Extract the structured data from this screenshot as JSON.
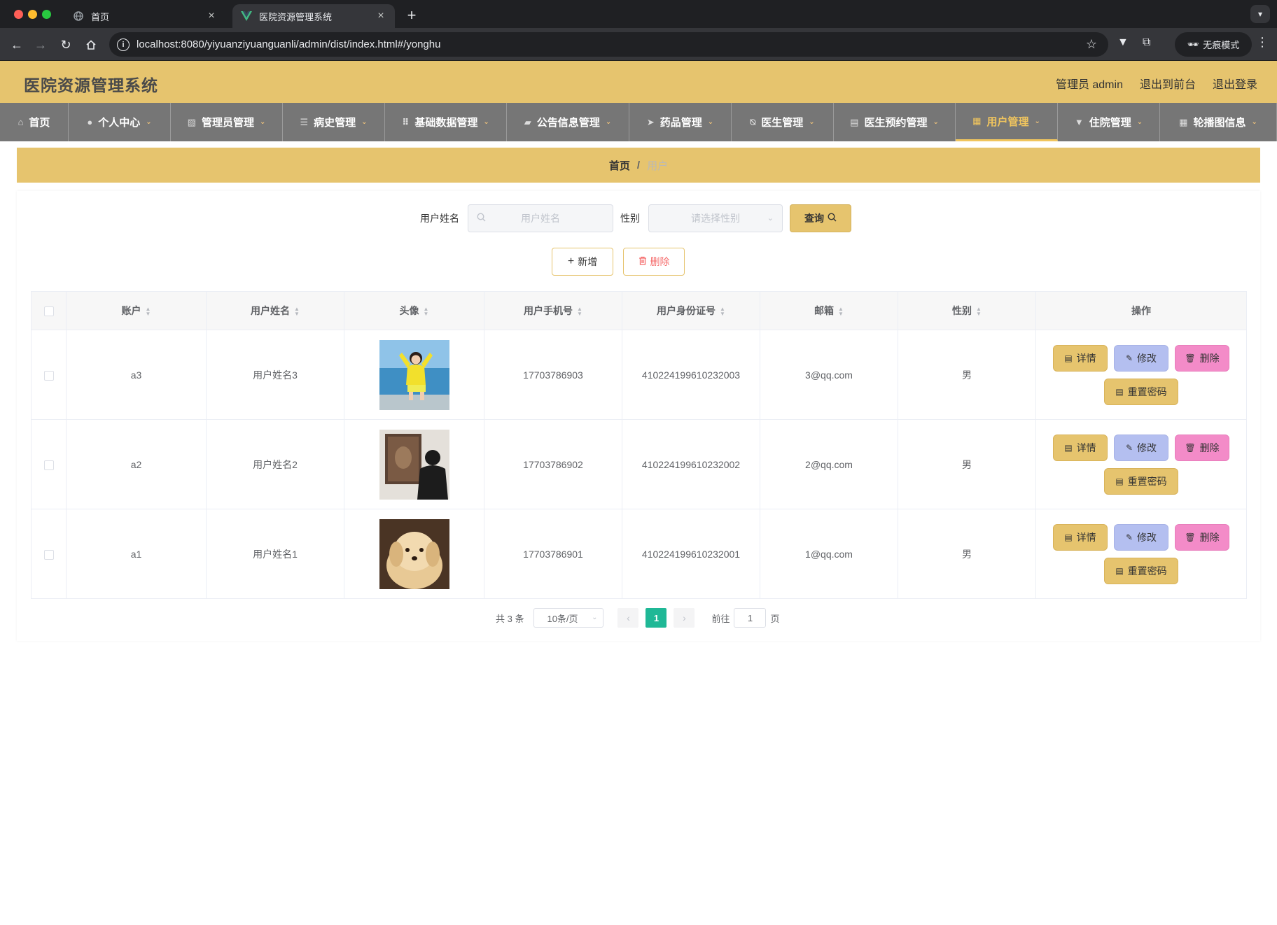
{
  "browser": {
    "tabs": [
      {
        "title": "首页",
        "active": false
      },
      {
        "title": "医院资源管理系统",
        "active": true
      }
    ],
    "url": "localhost:8080/yiyuanziyuanguanli/admin/dist/index.html#/yonghu",
    "incognito_label": "无痕模式"
  },
  "header": {
    "title": "医院资源管理系统",
    "links": [
      "管理员 admin",
      "退出到前台",
      "退出登录"
    ]
  },
  "nav": [
    {
      "label": "首页",
      "icon": "home-icon",
      "has_caret": false
    },
    {
      "label": "个人中心",
      "icon": "user-icon",
      "has_caret": true
    },
    {
      "label": "管理员管理",
      "icon": "chart-icon",
      "has_caret": true
    },
    {
      "label": "病史管理",
      "icon": "list-icon",
      "has_caret": true
    },
    {
      "label": "基础数据管理",
      "icon": "grid-icon",
      "has_caret": true
    },
    {
      "label": "公告信息管理",
      "icon": "ticket-icon",
      "has_caret": true
    },
    {
      "label": "药品管理",
      "icon": "send-icon",
      "has_caret": true
    },
    {
      "label": "医生管理",
      "icon": "bell-off-icon",
      "has_caret": true
    },
    {
      "label": "医生预约管理",
      "icon": "briefcase-icon",
      "has_caret": true
    },
    {
      "label": "用户管理",
      "icon": "clipboard-icon",
      "has_caret": true,
      "active": true
    },
    {
      "label": "住院管理",
      "icon": "flag-icon",
      "has_caret": true
    },
    {
      "label": "轮播图信息",
      "icon": "apps-icon",
      "has_caret": true
    }
  ],
  "breadcrumb": {
    "home": "首页",
    "separator": "/",
    "current": "用户"
  },
  "search": {
    "name_label": "用户姓名",
    "name_placeholder": "用户姓名",
    "gender_label": "性别",
    "gender_placeholder": "请选择性别",
    "query_label": "查询"
  },
  "actions": {
    "add_label": "新增",
    "delete_label": "删除"
  },
  "table": {
    "columns": [
      "账户",
      "用户姓名",
      "头像",
      "用户手机号",
      "用户身份证号",
      "邮箱",
      "性别",
      "操作"
    ],
    "rows": [
      {
        "account": "a3",
        "name": "用户姓名3",
        "avatar": "girl-yellow-sweater-photo",
        "phone": "17703786903",
        "id_number": "410224199610232003",
        "email": "3@qq.com",
        "gender": "男"
      },
      {
        "account": "a2",
        "name": "用户姓名2",
        "avatar": "person-painting-photo",
        "phone": "17703786902",
        "id_number": "410224199610232002",
        "email": "2@qq.com",
        "gender": "男"
      },
      {
        "account": "a1",
        "name": "用户姓名1",
        "avatar": "puppy-photo",
        "phone": "17703786901",
        "id_number": "410224199610232001",
        "email": "1@qq.com",
        "gender": "男"
      }
    ],
    "row_actions": {
      "detail": "详情",
      "edit": "修改",
      "delete": "删除",
      "reset_password": "重置密码"
    }
  },
  "pagination": {
    "total_text": "共 3 条",
    "page_size": "10条/页",
    "current_page": "1",
    "goto_label": "前往",
    "goto_value": "1",
    "page_suffix": "页"
  },
  "colors": {
    "header_bg": "#e6c46e",
    "nav_bg": "#767676",
    "nav_active": "#f0c55e",
    "btn_edit": "#b4bff0",
    "btn_delete": "#f38bc8",
    "pager_active": "#1fb896"
  }
}
